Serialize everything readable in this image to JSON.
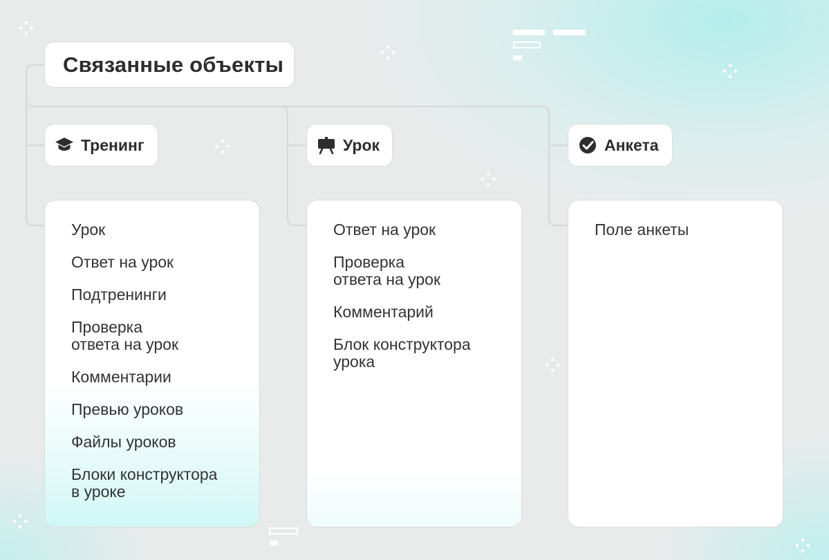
{
  "title": "Связанные объекты",
  "categories": [
    {
      "label": "Тренинг",
      "icon": "graduation-cap-icon",
      "items": [
        "Урок",
        "Ответ на урок",
        "Подтренинги",
        "Проверка\nответа на урок",
        "Комментарии",
        "Превью уроков",
        "Файлы уроков",
        "Блоки конструктора\nв уроке"
      ]
    },
    {
      "label": "Урок",
      "icon": "presentation-board-icon",
      "items": [
        "Ответ на урок",
        "Проверка\nответа на урок",
        "Комментарий",
        "Блок конструктора\nурока"
      ]
    },
    {
      "label": "Анкета",
      "icon": "check-circle-icon",
      "items": [
        "Поле анкеты"
      ]
    }
  ],
  "colors": {
    "text": "#2d2d2d",
    "connector": "#d4d8d8",
    "accent": "#aeeeed",
    "card": "#ffffff"
  }
}
